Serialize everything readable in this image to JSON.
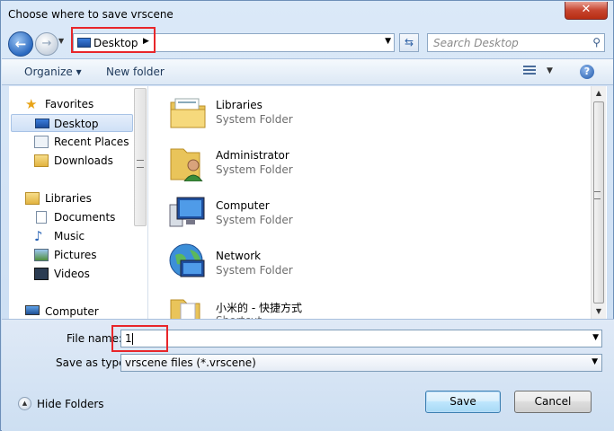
{
  "window": {
    "title": "Choose where to save vrscene",
    "close_label": "✕"
  },
  "address": {
    "location": "Desktop",
    "location_icon": "desktop-icon",
    "search_placeholder": "Search Desktop"
  },
  "toolbar": {
    "organize_label": "Organize ▾",
    "new_folder_label": "New folder",
    "help_label": "?"
  },
  "sidebar": {
    "items": [
      {
        "label": "Favorites",
        "icon": "star-icon"
      },
      {
        "label": "Desktop",
        "icon": "desktop-icon",
        "selected": true
      },
      {
        "label": "Recent Places",
        "icon": "recent-places-icon"
      },
      {
        "label": "Downloads",
        "icon": "downloads-folder-icon"
      },
      {
        "label": "Libraries",
        "icon": "libraries-icon"
      },
      {
        "label": "Documents",
        "icon": "documents-icon"
      },
      {
        "label": "Music",
        "icon": "music-icon"
      },
      {
        "label": "Pictures",
        "icon": "pictures-icon"
      },
      {
        "label": "Videos",
        "icon": "videos-icon"
      },
      {
        "label": "Computer",
        "icon": "computer-icon"
      }
    ]
  },
  "files": [
    {
      "name": "Libraries",
      "type": "System Folder",
      "icon": "libraries-folder-icon"
    },
    {
      "name": "Administrator",
      "type": "System Folder",
      "icon": "user-folder-icon"
    },
    {
      "name": "Computer",
      "type": "System Folder",
      "icon": "computer-icon"
    },
    {
      "name": "Network",
      "type": "System Folder",
      "icon": "network-globe-icon"
    },
    {
      "name": "小米的 - 快捷方式",
      "type": "Shortcut",
      "icon": "shortcut-folder-icon"
    }
  ],
  "form": {
    "file_name_label": "File name:",
    "file_name_value": "1",
    "save_as_type_label": "Save as type:",
    "save_as_type_value": "vrscene files (*.vrscene)"
  },
  "footer": {
    "hide_folders_label": "Hide Folders",
    "save_label": "Save",
    "cancel_label": "Cancel"
  }
}
